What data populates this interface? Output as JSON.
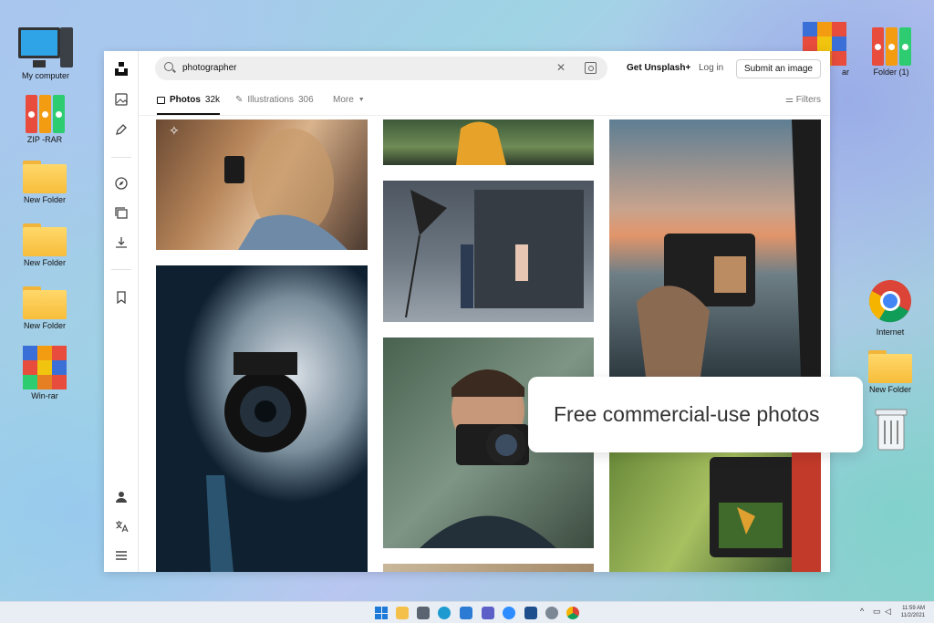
{
  "desktop": {
    "left_icons": [
      {
        "label": "My computer"
      },
      {
        "label": "ZIP -RAR"
      },
      {
        "label": "New Folder"
      },
      {
        "label": "New Folder"
      },
      {
        "label": "New Folder"
      },
      {
        "label": "Win-rar"
      }
    ],
    "right_icons": [
      {
        "label": "ar"
      },
      {
        "label": "Folder (1)"
      },
      {
        "label": "Internet"
      },
      {
        "label": "New Folder"
      }
    ]
  },
  "browser": {
    "search": {
      "value": "photographer"
    },
    "header_links": {
      "get_plus": "Get Unsplash+",
      "login": "Log in",
      "submit": "Submit an image"
    },
    "tabs": [
      {
        "label": "Photos",
        "count": "32k",
        "active": true
      },
      {
        "label": "Illustrations",
        "count": "306",
        "active": false
      },
      {
        "label": "More",
        "count": "",
        "active": false
      }
    ],
    "filters_label": "Filters"
  },
  "overlay_card": {
    "text": "Free commercial-use photos"
  },
  "taskbar": {
    "time": "11:59 AM",
    "date": "11/2/2021"
  },
  "colors": {
    "folder": "#f7bd3b",
    "accent_dark": "#111111",
    "window_bg": "#ffffff"
  }
}
